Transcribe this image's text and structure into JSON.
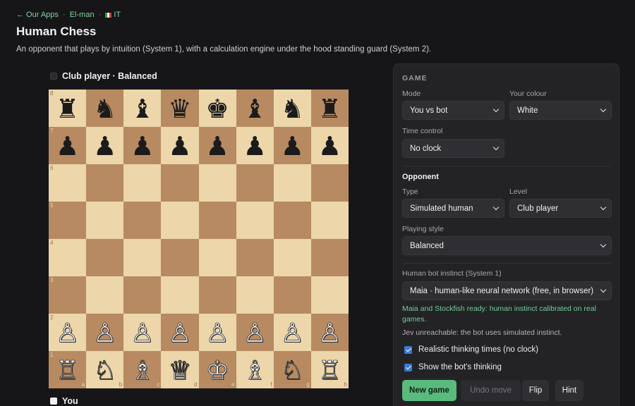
{
  "breadcrumb": {
    "back": "← Our Apps",
    "sep1": "·",
    "app": "El-man",
    "sep2": "·",
    "lang": "IT"
  },
  "page": {
    "title": "Human Chess",
    "subtitle": "An opponent that plays by intuition (System 1), with a calculation engine under the hood standing guard (System 2)."
  },
  "players": {
    "top": "Club player · Balanced",
    "bottom": "You"
  },
  "board": {
    "files": [
      "a",
      "b",
      "c",
      "d",
      "e",
      "f",
      "g",
      "h"
    ],
    "ranks": [
      "8",
      "7",
      "6",
      "5",
      "4",
      "3",
      "2",
      "1"
    ],
    "position": [
      [
        "♜",
        "♞",
        "♝",
        "♛",
        "♚",
        "♝",
        "♞",
        "♜"
      ],
      [
        "♟",
        "♟",
        "♟",
        "♟",
        "♟",
        "♟",
        "♟",
        "♟"
      ],
      [
        "",
        "",
        "",
        "",
        "",
        "",
        "",
        ""
      ],
      [
        "",
        "",
        "",
        "",
        "",
        "",
        "",
        ""
      ],
      [
        "",
        "",
        "",
        "",
        "",
        "",
        "",
        ""
      ],
      [
        "",
        "",
        "",
        "",
        "",
        "",
        "",
        ""
      ],
      [
        "♙",
        "♙",
        "♙",
        "♙",
        "♙",
        "♙",
        "♙",
        "♙"
      ],
      [
        "♖",
        "♘",
        "♗",
        "♕",
        "♔",
        "♗",
        "♘",
        "♖"
      ]
    ],
    "piece_colors": [
      [
        "b",
        "b",
        "b",
        "b",
        "b",
        "b",
        "b",
        "b"
      ],
      [
        "b",
        "b",
        "b",
        "b",
        "b",
        "b",
        "b",
        "b"
      ],
      [
        "",
        "",
        "",
        "",
        "",
        "",
        "",
        ""
      ],
      [
        "",
        "",
        "",
        "",
        "",
        "",
        "",
        ""
      ],
      [
        "",
        "",
        "",
        "",
        "",
        "",
        "",
        ""
      ],
      [
        "",
        "",
        "",
        "",
        "",
        "",
        "",
        ""
      ],
      [
        "w",
        "w",
        "w",
        "w",
        "w",
        "w",
        "w",
        "w"
      ],
      [
        "w",
        "w",
        "w",
        "w",
        "w",
        "w",
        "w",
        "w"
      ]
    ]
  },
  "panel": {
    "heading": "GAME",
    "mode": {
      "label": "Mode",
      "value": "You vs bot"
    },
    "colour": {
      "label": "Your colour",
      "value": "White"
    },
    "time_control": {
      "label": "Time control",
      "value": "No clock"
    },
    "opponent": {
      "heading": "Opponent",
      "type": {
        "label": "Type",
        "value": "Simulated human"
      },
      "level": {
        "label": "Level",
        "value": "Club player"
      },
      "style": {
        "label": "Playing style",
        "value": "Balanced"
      }
    },
    "instinct": {
      "label": "Human bot instinct (System 1)",
      "value": "Maia · human-like neural network (free, in browser)"
    },
    "status_ready": "Maia and Stockfish ready: human instinct calibrated on real games.",
    "status_jev": "Jev unreachable: the bot uses simulated instinct.",
    "checks": {
      "thinking_times": "Realistic thinking times (no clock)",
      "show_thinking": "Show the bot's thinking"
    },
    "buttons": {
      "new_game": "New game",
      "undo": "Undo move",
      "flip": "Flip",
      "hint": "Hint"
    }
  },
  "colors": {
    "light_square": "#ecd6aa",
    "dark_square": "#b78a62",
    "accent_green": "#5aba7e",
    "checkbox_blue": "#3a7bd5"
  }
}
